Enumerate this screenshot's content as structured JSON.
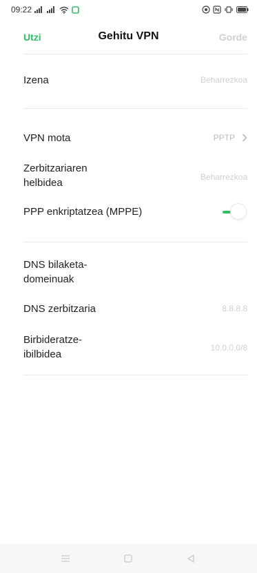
{
  "status_bar": {
    "time": "09:22",
    "icons": [
      "signal-icon",
      "signal-icon",
      "wifi-icon",
      "notification-icon",
      "eye-icon",
      "nfc-icon",
      "vibrate-icon",
      "battery-icon"
    ]
  },
  "header": {
    "cancel_label": "Utzi",
    "title": "Gehitu VPN",
    "save_label": "Gorde"
  },
  "form": {
    "name": {
      "label": "Izena",
      "placeholder": "Beharrezkoa"
    },
    "vpn_type": {
      "label": "VPN mota",
      "value": "PPTP"
    },
    "server_address": {
      "label_line1": "Zerbitzariaren",
      "label_line2": "helbidea",
      "placeholder": "Beharrezkoa"
    },
    "ppp_encryption": {
      "label": "PPP enkriptatzea (MPPE)",
      "enabled": true
    },
    "dns_search_domains": {
      "label_line1": "DNS bilaketa-",
      "label_line2": "domeinuak"
    },
    "dns_server": {
      "label": "DNS zerbitzaria",
      "placeholder": "8.8.8.8"
    },
    "forwarding_route": {
      "label_line1": "Birbideratze-",
      "label_line2": "ibilbidea",
      "placeholder": "10.0.0.0/8"
    }
  },
  "colors": {
    "accent": "#2fbf63",
    "disabled_text": "#cfcfcf",
    "divider": "#e8e8e8",
    "nav_bar": "#f7f7f7"
  }
}
